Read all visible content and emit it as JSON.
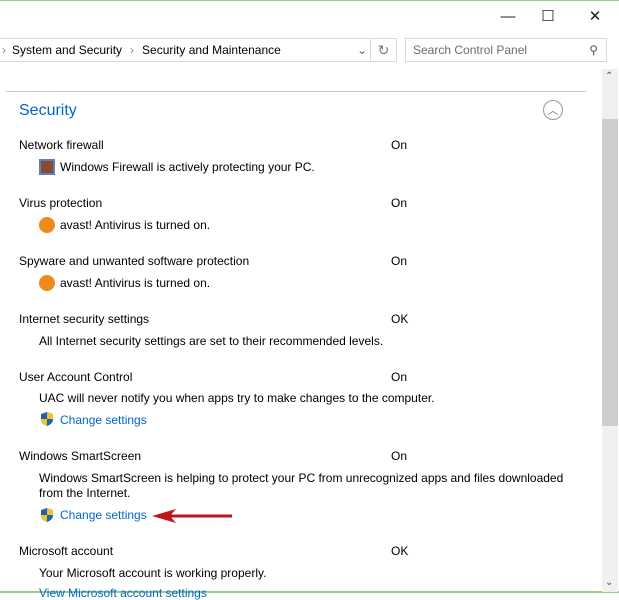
{
  "window": {
    "minimize": "—",
    "maximize": "☐",
    "close": "✕"
  },
  "breadcrumb": [
    "System and Security",
    "Security and Maintenance"
  ],
  "search": {
    "placeholder": "Search Control Panel"
  },
  "section": {
    "title": "Security"
  },
  "items": [
    {
      "title": "Network firewall",
      "status": "On",
      "desc": "Windows Firewall is actively protecting your PC.",
      "icon": "firewall-icon"
    },
    {
      "title": "Virus protection",
      "status": "On",
      "desc": "avast! Antivirus is turned on.",
      "icon": "avast-icon"
    },
    {
      "title": "Spyware and unwanted software protection",
      "status": "On",
      "desc": "avast! Antivirus is turned on.",
      "icon": "avast-icon"
    },
    {
      "title": "Internet security settings",
      "status": "OK",
      "desc": "All Internet security settings are set to their recommended levels."
    },
    {
      "title": "User Account Control",
      "status": "On",
      "desc": "UAC will never notify you when apps try to make changes to the computer.",
      "link": "Change settings"
    },
    {
      "title": "Windows SmartScreen",
      "status": "On",
      "desc": "Windows SmartScreen is helping to protect your PC from unrecognized apps and files downloaded from the Internet.",
      "link": "Change settings"
    },
    {
      "title": "Microsoft account",
      "status": "OK",
      "desc": "Your Microsoft account is working properly.",
      "link": "View Microsoft account settings"
    }
  ],
  "colors": {
    "link": "#0066cc",
    "arrow": "#c0151b",
    "border": "#9bd07a"
  }
}
